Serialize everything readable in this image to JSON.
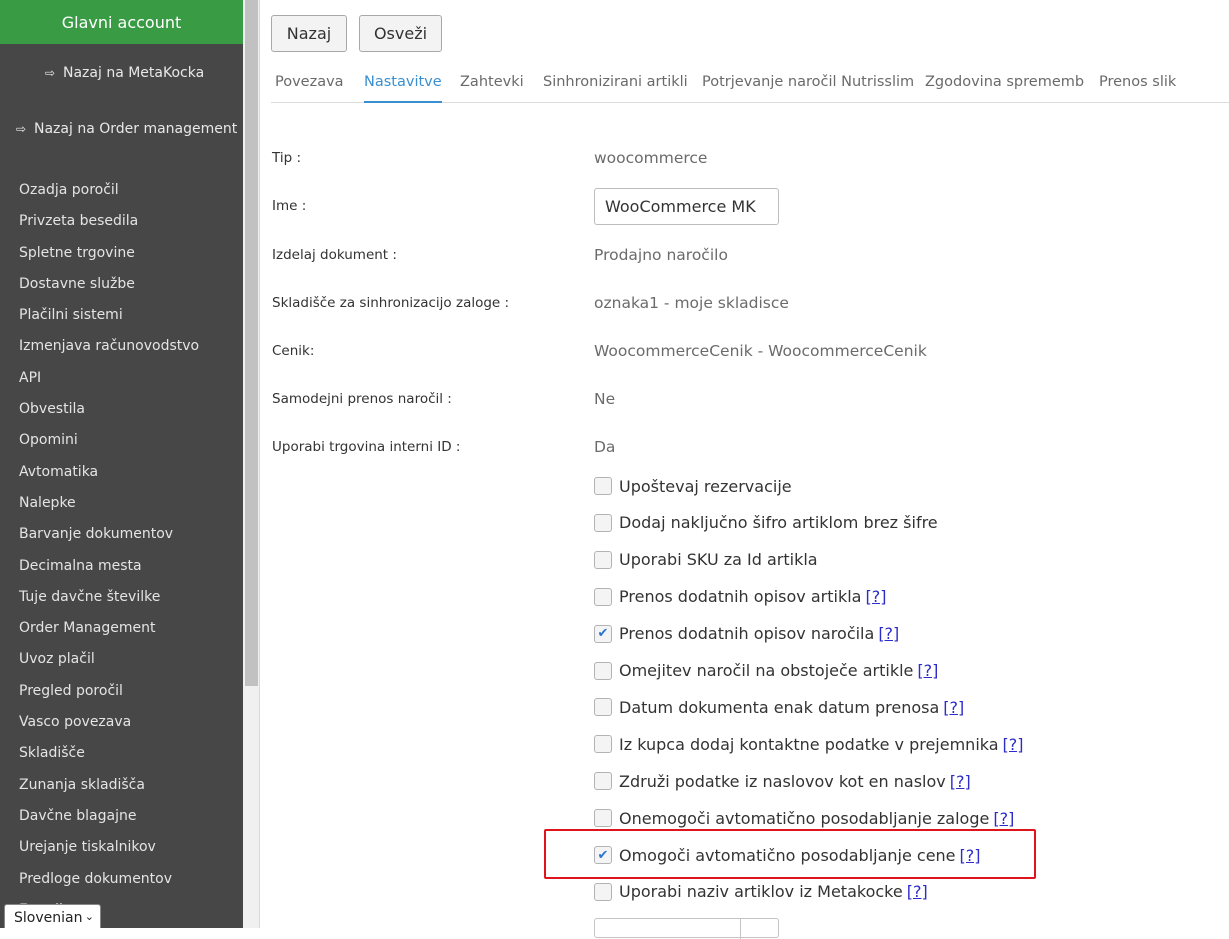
{
  "sidebar": {
    "header": "Glavni account",
    "back_metakocka": "Nazaj na MetaKocka",
    "back_order_management": "Nazaj na Order management",
    "items": [
      "Ozadja poročil",
      "Privzeta besedila",
      "Spletne trgovine",
      "Dostavne službe",
      "Plačilni sistemi",
      "Izmenjava računovodstvo",
      "API",
      "Obvestila",
      "Opomini",
      "Avtomatika",
      "Nalepke",
      "Barvanje dokumentov",
      "Decimalna mesta",
      "Tuje davčne številke",
      "Order Management",
      "Uvoz plačil",
      "Pregled poročil",
      "Vasco povezava",
      "Skladišče",
      "Zunanja skladišča",
      "Davčne blagajne",
      "Urejanje tiskalnikov",
      "Predloge dokumentov",
      "E-mail"
    ],
    "language": "Slovenian"
  },
  "toolbar": {
    "back_label": "Nazaj",
    "refresh_label": "Osveži"
  },
  "tabs": [
    {
      "label": "Povezava",
      "active": false
    },
    {
      "label": "Nastavitve",
      "active": true
    },
    {
      "label": "Zahtevki",
      "active": false
    },
    {
      "label": "Sinhronizirani artikli",
      "active": false
    },
    {
      "label": "Potrjevanje naročil Nutrisslim",
      "active": false
    },
    {
      "label": "Zgodovina sprememb",
      "active": false
    },
    {
      "label": "Prenos slik",
      "active": false
    }
  ],
  "fields": {
    "type_label": "Tip :",
    "type_value": "woocommerce",
    "name_label": "Ime :",
    "name_value": "WooCommerce MK",
    "document_label": "Izdelaj dokument :",
    "document_value": "Prodajno naročilo",
    "warehouse_label": "Skladišče za sinhronizacijo zaloge :",
    "warehouse_value": "oznaka1 - moje skladisce",
    "pricelist_label": "Cenik:",
    "pricelist_value": "WoocommerceCenik - WoocommerceCenik",
    "auto_transfer_label": "Samodejni prenos naročil :",
    "auto_transfer_value": "Ne",
    "internal_id_label": "Uporabi trgovina interni ID :",
    "internal_id_value": "Da"
  },
  "help_marker": "[?]",
  "options": [
    {
      "label": "Upoštevaj rezervacije",
      "checked": false,
      "help": false
    },
    {
      "label": "Dodaj naključno šifro artiklom brez šifre",
      "checked": false,
      "help": false
    },
    {
      "label": "Uporabi SKU za Id artikla",
      "checked": false,
      "help": false
    },
    {
      "label": "Prenos dodatnih opisov artikla",
      "checked": false,
      "help": true
    },
    {
      "label": "Prenos dodatnih opisov naročila",
      "checked": true,
      "help": true
    },
    {
      "label": "Omejitev naročil na obstoječe artikle",
      "checked": false,
      "help": true
    },
    {
      "label": "Datum dokumenta enak datum prenosa",
      "checked": false,
      "help": true
    },
    {
      "label": "Iz kupca dodaj kontaktne podatke v prejemnika",
      "checked": false,
      "help": true
    },
    {
      "label": "Združi podatke iz naslovov kot en naslov",
      "checked": false,
      "help": true
    },
    {
      "label": "Onemogoči avtomatično posodabljanje zaloge",
      "checked": false,
      "help": true
    },
    {
      "label": "Omogoči avtomatično posodabljanje cene",
      "checked": true,
      "help": true
    },
    {
      "label": "Uporabi naziv artiklov iz Metakocke",
      "checked": false,
      "help": true
    }
  ],
  "colors": {
    "sidebar_bg": "#474747",
    "header_green": "#3a9b45",
    "active_tab": "#3a8fd0",
    "highlight_red": "#e0141b",
    "help_link": "#2c2cc9"
  }
}
